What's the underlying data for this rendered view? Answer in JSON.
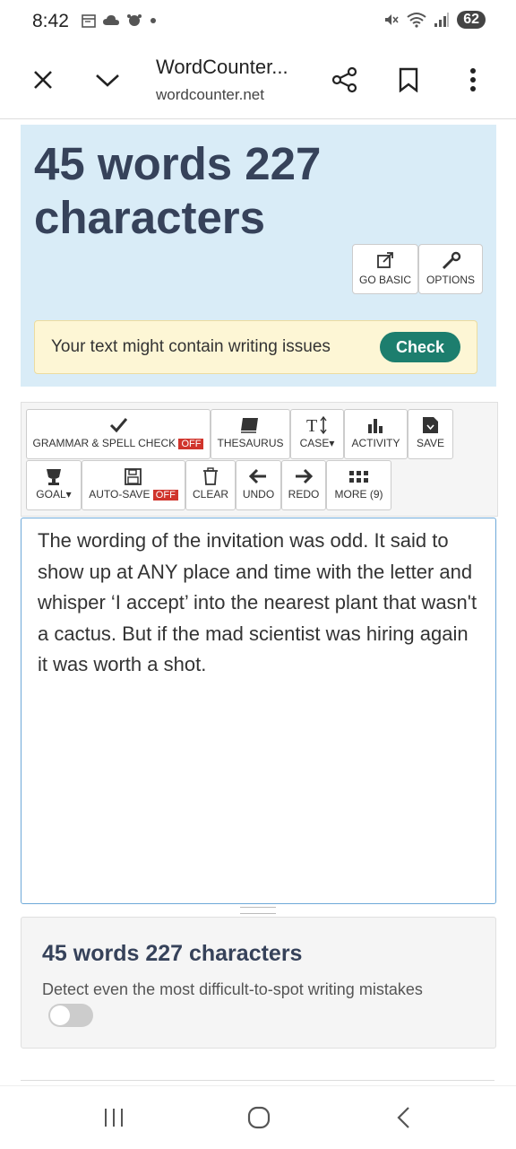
{
  "status_bar": {
    "time": "8:42",
    "battery": "62",
    "left_icons": [
      "calendar-icon",
      "cloud-icon",
      "weather-icon",
      "dot-icon"
    ],
    "right_icons": [
      "mute-icon",
      "wifi-icon",
      "signal-icon"
    ]
  },
  "browser": {
    "title": "WordCounter...",
    "url": "wordcounter.net"
  },
  "hero": {
    "title": "45 words 227 characters",
    "go_basic": "GO BASIC",
    "options": "OPTIONS",
    "issue_text": "Your text might contain writing issues",
    "check": "Check"
  },
  "toolbar": {
    "grammar": "GRAMMAR & SPELL CHECK",
    "grammar_state": "OFF",
    "thesaurus": "THESAURUS",
    "case": "CASE",
    "activity": "ACTIVITY",
    "save": "SAVE",
    "goal": "GOAL",
    "autosave": "AUTO-SAVE",
    "autosave_state": "OFF",
    "clear": "CLEAR",
    "undo": "UNDO",
    "redo": "REDO",
    "more": "MORE (9)"
  },
  "editor": {
    "text": "The wording of the invitation was odd. It said to show up at ANY place and time with the letter and whisper ‘I accept’ into the nearest plant that wasn't a cactus. But if the mad scientist was hiring again it was worth a shot."
  },
  "stats": {
    "title": "45 words 227 characters",
    "description": "Detect even the most difficult-to-spot writing mistakes",
    "toggle_on": false
  },
  "colors": {
    "hero_bg": "#d9ecf7",
    "title": "#36425a",
    "check_button": "#1d7e6e",
    "off_badge": "#d0342c"
  }
}
